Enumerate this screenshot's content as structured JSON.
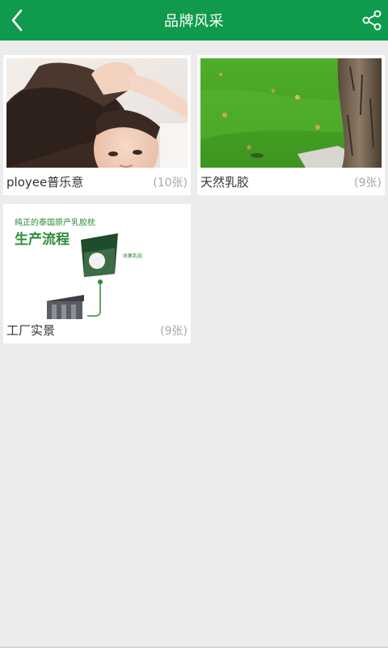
{
  "header": {
    "title": "品牌风采",
    "back_icon": "chevron-left-icon",
    "share_icon": "share-icon",
    "background": "#0f9a4e"
  },
  "albums": [
    {
      "label": "ployee普乐意",
      "count": "(10张)"
    },
    {
      "label": "天然乳胶",
      "count": "(9张)"
    },
    {
      "label": "工厂实景",
      "count": "(9张)",
      "image_texts": {
        "headline": "纯正的泰国原产乳胶枕",
        "subtitle": "生产流程",
        "step": "收集乳胶"
      }
    }
  ]
}
